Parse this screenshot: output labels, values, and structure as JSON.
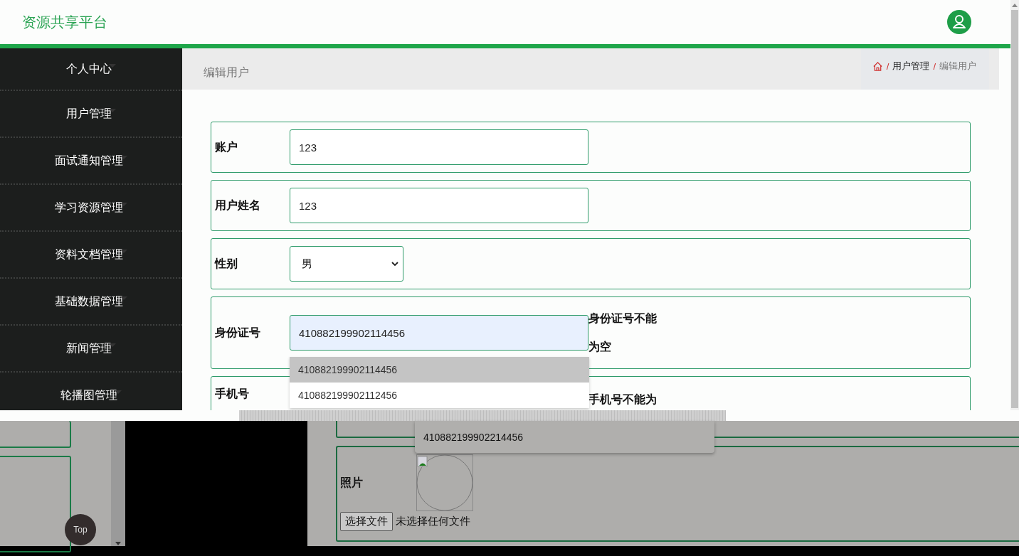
{
  "header": {
    "title": "资源共享平台"
  },
  "sidebar": {
    "items": [
      {
        "label": "个人中心"
      },
      {
        "label": "用户管理"
      },
      {
        "label": "面试通知管理"
      },
      {
        "label": "学习资源管理"
      },
      {
        "label": "资料文档管理"
      },
      {
        "label": "基础数据管理"
      },
      {
        "label": "新闻管理"
      },
      {
        "label": "轮播图管理"
      }
    ]
  },
  "page_title": "编辑用户",
  "breadcrumb": [
    {
      "separator": "/",
      "label": "用户管理",
      "kind": "link"
    },
    {
      "separator": "/",
      "label": "编辑用户",
      "kind": "current"
    }
  ],
  "form": {
    "fields": [
      {
        "kind": "text",
        "label": "账户",
        "value": "123",
        "focused": false
      },
      {
        "kind": "text",
        "label": "用户姓名",
        "value": "123",
        "focused": false
      },
      {
        "kind": "select",
        "label": "性别",
        "value": "男"
      },
      {
        "kind": "text",
        "label": "身份证号",
        "value": "410882199902114456",
        "focused": true,
        "error": "身份证号不能为空",
        "suggestions": [
          {
            "text": "410882199902114456",
            "selected": true
          },
          {
            "text": "410882199902112456",
            "selected": false
          }
        ]
      },
      {
        "kind": "cut",
        "label": "手机号",
        "error": "手机号不能为"
      }
    ]
  },
  "lower_layer": {
    "suggestion": "410882199902214456",
    "photo": {
      "label": "照片",
      "button": "选择文件",
      "file_status": "未选择任何文件"
    },
    "top_button": "Top"
  }
}
